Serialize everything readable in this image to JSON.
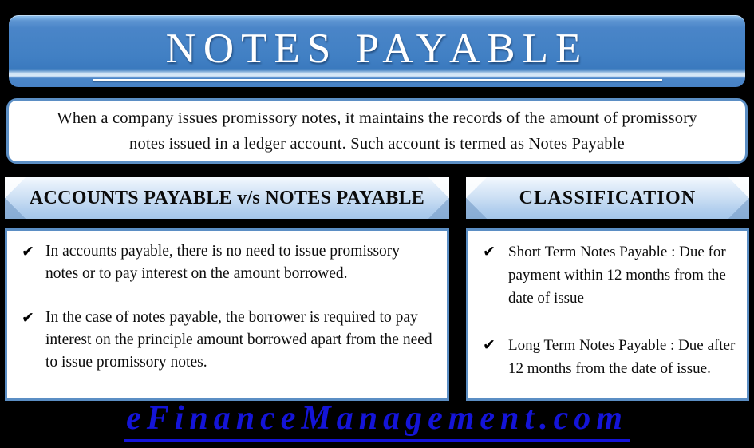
{
  "title": {
    "text": "NOTES PAYABLE"
  },
  "description": {
    "text": "When a company issues promissory notes, it maintains the records of the amount of promissory notes issued in a ledger account. Such account is termed as Notes Payable"
  },
  "columns": [
    {
      "id": "comparison",
      "banner_label": "ACCOUNTS PAYABLE v/s NOTES PAYABLE",
      "bullet_marker": "✔",
      "bullets": [
        "In accounts payable, there is no need to issue promissory notes or to pay interest on the amount borrowed.",
        "In the case of notes payable, the borrower is required to pay interest on the principle amount borrowed apart from the need to issue promissory notes."
      ]
    },
    {
      "id": "classification",
      "banner_label": "CLASSIFICATION",
      "bullet_marker": "✔",
      "bullets": [
        "Short Term Notes Payable : Due for payment within  12 months from the date of issue",
        "Long Term Notes Payable : Due after 12 months from the date of issue."
      ]
    }
  ],
  "footer": {
    "text": "eFinanceManagement.com"
  },
  "colors": {
    "background": "#000000",
    "title_bar_blue": "#4180c4",
    "border_blue": "#5b8ec4",
    "banner_light": "#f4f9fe",
    "banner_dark": "#a4c6e9",
    "footer_blue": "#1414d8",
    "panel_white": "#ffffff",
    "body_text": "#0d0d0d"
  }
}
